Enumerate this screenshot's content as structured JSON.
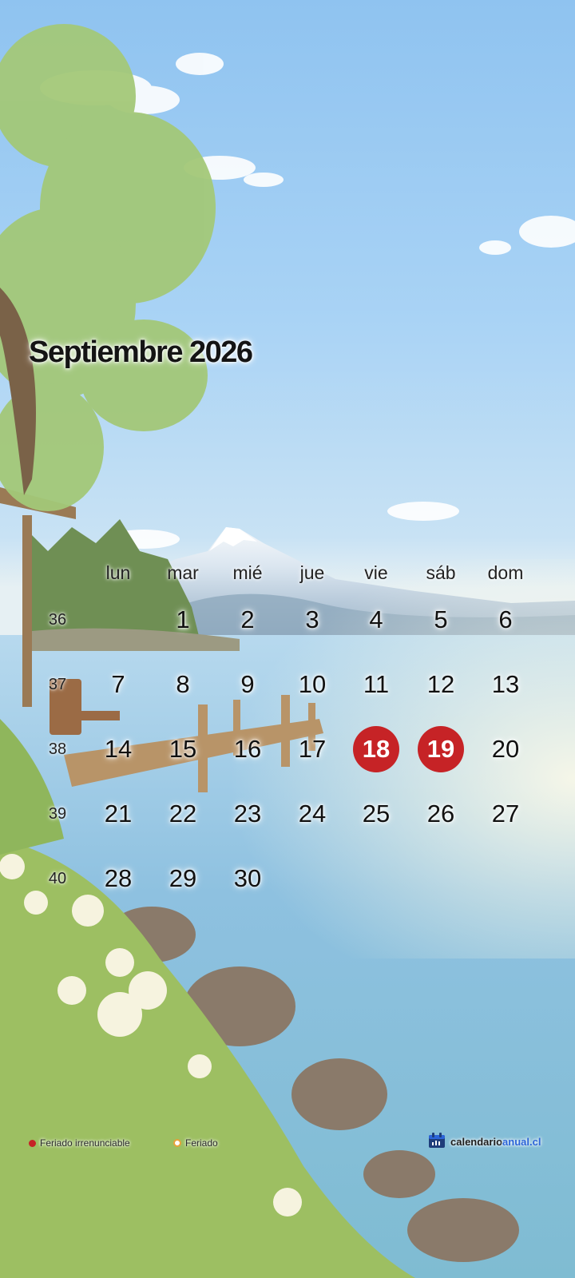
{
  "calendar": {
    "title": "Septiembre 2026",
    "weekdays": [
      "lun",
      "mar",
      "mié",
      "jue",
      "vie",
      "sáb",
      "dom"
    ],
    "weeks": [
      {
        "number": "36",
        "days": [
          "",
          "1",
          "2",
          "3",
          "4",
          "5",
          "6"
        ]
      },
      {
        "number": "37",
        "days": [
          "7",
          "8",
          "9",
          "10",
          "11",
          "12",
          "13"
        ]
      },
      {
        "number": "38",
        "days": [
          "14",
          "15",
          "16",
          "17",
          "18",
          "19",
          "20"
        ]
      },
      {
        "number": "39",
        "days": [
          "21",
          "22",
          "23",
          "24",
          "25",
          "26",
          "27"
        ]
      },
      {
        "number": "40",
        "days": [
          "28",
          "29",
          "30",
          "",
          "",
          "",
          ""
        ]
      }
    ],
    "holidays": [
      {
        "day": "18",
        "type": "irrenunciable"
      },
      {
        "day": "19",
        "type": "irrenunciable"
      }
    ]
  },
  "legend": {
    "irrenunciable_label": "Feriado irrenunciable",
    "irrenunciable_color": "#c62326",
    "feriado_label": "Feriado",
    "feriado_color": "#e8a23a"
  },
  "brand": {
    "name_part1": "calendario",
    "name_part2": "anual.cl",
    "icon": "calendar-icon",
    "accent": "#2b64d8"
  }
}
